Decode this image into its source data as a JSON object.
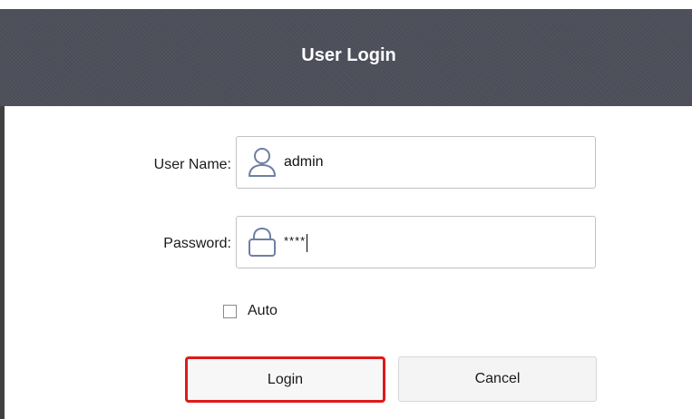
{
  "dialog": {
    "title": "User Login"
  },
  "form": {
    "username_label": "User Name:",
    "username_value": "admin",
    "username_icon": "user-icon",
    "password_label": "Password:",
    "password_value": "****",
    "password_icon": "lock-icon",
    "auto_label": "Auto",
    "auto_checked": false
  },
  "buttons": {
    "login_label": "Login",
    "cancel_label": "Cancel"
  },
  "colors": {
    "header_bg": "#4d4f5a",
    "icon_blue": "#6f7fa3",
    "focus_red": "#e01919"
  }
}
